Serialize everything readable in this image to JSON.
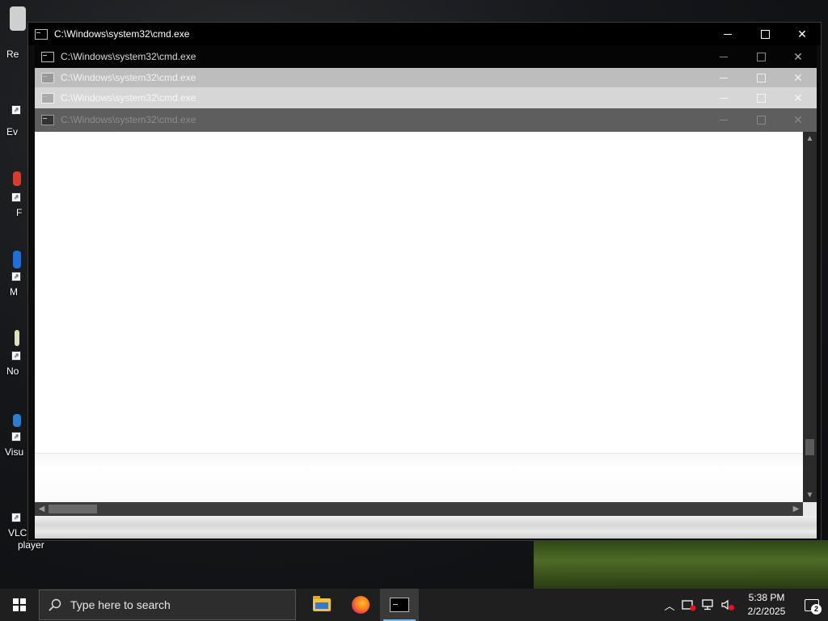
{
  "desktop": {
    "icons": [
      {
        "label": "Re",
        "color": "#cfcfcf"
      },
      {
        "label": "Ev",
        "color": "#3a6fb8"
      },
      {
        "label": "F",
        "color": "#d93c2c"
      },
      {
        "label": "M",
        "color": "#1e6fd9"
      },
      {
        "label": "No",
        "color": "#e0e0c0"
      },
      {
        "label": "Visu",
        "color": "#2b7dd1"
      },
      {
        "label": "VLC",
        "label2": "player",
        "color": "#f08a18"
      }
    ]
  },
  "windows": {
    "main": {
      "title": "C:\\Windows\\system32\\cmd.exe"
    },
    "ghost1": {
      "title": "C:\\Windows\\system32\\cmd.exe"
    },
    "ghost2": {
      "title": "C:\\Windows\\system32\\cmd.exe"
    },
    "ghost3": {
      "title": "C:\\Windows\\system32\\cmd.exe"
    },
    "ghost4": {
      "title": "C:\\Windows\\system32\\cmd.exe"
    }
  },
  "taskbar": {
    "search_placeholder": "Type here to search",
    "apps": [
      "file-explorer",
      "firefox",
      "command-prompt"
    ],
    "clock_time": "5:38 PM",
    "clock_date": "2/2/2025",
    "notification_count": "2"
  }
}
